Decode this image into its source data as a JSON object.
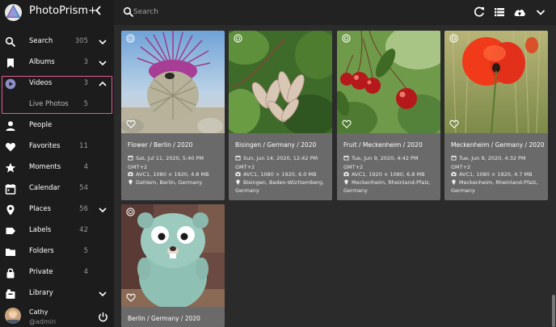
{
  "app": {
    "name": "PhotoPrism+"
  },
  "search": {
    "placeholder": "Search"
  },
  "sidebar": {
    "items": [
      {
        "label": "Search",
        "count": "305",
        "icon": "search-icon"
      },
      {
        "label": "Albums",
        "count": "3",
        "icon": "bookmark-icon"
      },
      {
        "label": "Videos",
        "count": "3",
        "icon": "play-circle-icon"
      },
      {
        "label": "Live Photos",
        "count": "5",
        "icon": ""
      },
      {
        "label": "People",
        "count": "",
        "icon": "person-icon"
      },
      {
        "label": "Favorites",
        "count": "11",
        "icon": "heart-icon"
      },
      {
        "label": "Moments",
        "count": "4",
        "icon": "star-icon"
      },
      {
        "label": "Calendar",
        "count": "54",
        "icon": "calendar-icon"
      },
      {
        "label": "Places",
        "count": "56",
        "icon": "map-pin-icon"
      },
      {
        "label": "Labels",
        "count": "42",
        "icon": "label-icon"
      },
      {
        "label": "Folders",
        "count": "5",
        "icon": "folder-icon"
      },
      {
        "label": "Private",
        "count": "4",
        "icon": "lock-icon"
      },
      {
        "label": "Library",
        "count": "",
        "icon": "library-icon"
      }
    ]
  },
  "user": {
    "name": "Cathy",
    "handle": "@admin"
  },
  "colors": {
    "sidebar": "#1c1c1c",
    "content": "#2b2b2b",
    "card": "#6a6a6a",
    "highlight": "#e05a8f"
  },
  "photos": [
    {
      "title": "Flower / Berlin / 2020",
      "date": "Sat, Jul 11, 2020, 5:40 PM",
      "tz": "GMT+2",
      "camera": "AVC1, 1080 × 1920, 4.8 MB",
      "location": "Dahlem, Berlin, Germany",
      "location2": ""
    },
    {
      "title": "Bisingen / Germany / 2020",
      "date": "Sun, Jun 14, 2020, 12:42 PM",
      "tz": "GMT+2",
      "camera": "AVC1, 1080 × 1920, 6.0 MB",
      "location": "Bisingen, Baden-Württemberg,",
      "location2": "Germany"
    },
    {
      "title": "Fruit / Meckenheim / 2020",
      "date": "Tue, Jun 9, 2020, 4:42 PM",
      "tz": "GMT+2",
      "camera": "AVC1, 1920 × 1080, 6.8 MB",
      "location": "Meckenheim, Rheinland-Pfalz,",
      "location2": "Germany"
    },
    {
      "title": "Meckenheim / Germany / 2020",
      "date": "Tue, Jun 9, 2020, 4:32 PM",
      "tz": "GMT+2",
      "camera": "AVC1, 1080 × 1920, 4.7 MB",
      "location": "Meckenheim, Rheinland-Pfalz,",
      "location2": "Germany"
    },
    {
      "title": "Berlin / Germany / 2020"
    }
  ]
}
